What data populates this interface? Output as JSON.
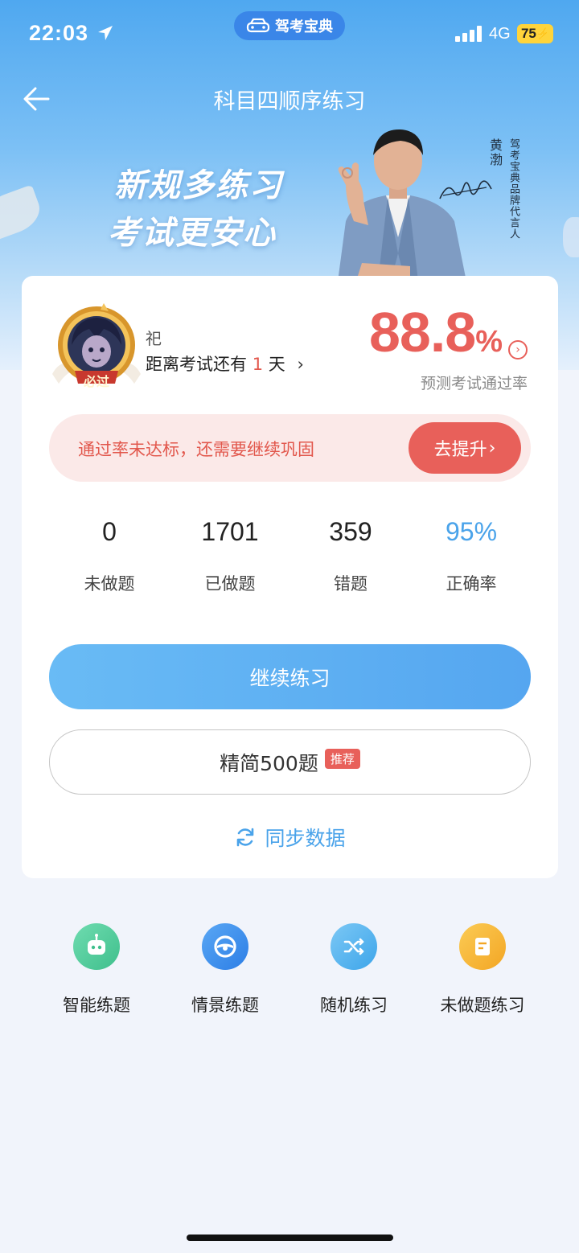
{
  "status_bar": {
    "time": "22:03",
    "app_name": "驾考宝典",
    "network": "4G",
    "battery": "75"
  },
  "nav": {
    "title": "科目四顺序练习"
  },
  "banner": {
    "slogan_line1": "新规多练习",
    "slogan_line2": "考试更安心",
    "spokesperson_name": "黄渤",
    "spokesperson_title": "驾考宝典品牌代言人"
  },
  "profile": {
    "badge_text": "必过",
    "user_name": "祀",
    "exam_prefix": "距离考试还有",
    "exam_days": "1",
    "exam_suffix": "天",
    "pass_rate_value": "88.8",
    "pass_rate_unit": "%",
    "pass_rate_caption": "预测考试通过率"
  },
  "alert": {
    "text": "通过率未达标，还需要继续巩固",
    "button_label": "去提升"
  },
  "stats": [
    {
      "value": "0",
      "label": "未做题"
    },
    {
      "value": "1701",
      "label": "已做题"
    },
    {
      "value": "359",
      "label": "错题"
    },
    {
      "value": "95%",
      "label": "正确率"
    }
  ],
  "actions": {
    "continue_label": "继续练习",
    "simple_label": "精简500题",
    "simple_tag": "推荐",
    "sync_label": "同步数据"
  },
  "quick_actions": [
    {
      "label": "智能练题",
      "icon": "robot-icon",
      "color": "#4cc99a"
    },
    {
      "label": "情景练题",
      "icon": "steering-wheel-icon",
      "color": "#3b8cec"
    },
    {
      "label": "随机练习",
      "icon": "shuffle-icon",
      "color": "#4fb2ee"
    },
    {
      "label": "未做题练习",
      "icon": "document-icon",
      "color": "#f6b332"
    }
  ],
  "colors": {
    "accent_blue": "#4aa3ea",
    "accent_red": "#e8605a"
  }
}
